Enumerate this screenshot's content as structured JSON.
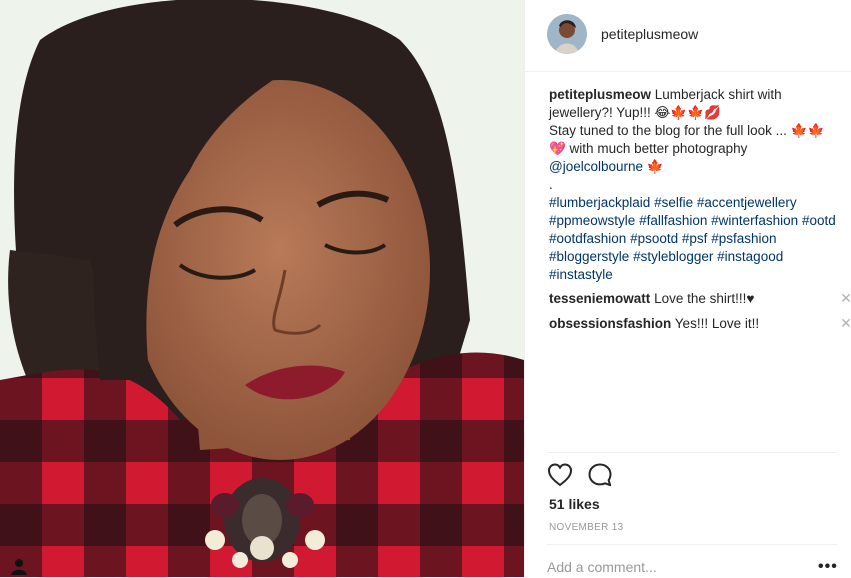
{
  "header": {
    "username": "petiteplusmeow"
  },
  "caption": {
    "username": "petiteplusmeow",
    "line1": "Lumberjack shirt with jewellery?! Yup!!! 😂🍁🍁💋",
    "line2": "Stay tuned to the blog for the full look ... 🍁🍁",
    "line3": "💖 with much better photography",
    "mention": "@joelcolbourne",
    "mention_suffix": " 🍁",
    "dot": ".",
    "hashtags": [
      "#lumberjackplaid",
      "#selfie",
      "#accentjewellery",
      "#ppmeowstyle",
      "#fallfashion",
      "#winterfashion",
      "#ootd",
      "#ootdfashion",
      "#psootd",
      "#psf",
      "#psfashion",
      "#bloggerstyle",
      "#styleblogger",
      "#instagood",
      "#instastyle"
    ]
  },
  "comments": [
    {
      "username": "tesseniemowatt",
      "text": "Love the shirt!!!♥",
      "delete_icon": "close-icon"
    },
    {
      "username": "obsessionsfashion",
      "text": "Yes!!! Love it!!",
      "delete_icon": "close-icon"
    }
  ],
  "actions": {
    "like_icon": "heart-icon",
    "comment_icon": "comment-bubble-icon"
  },
  "likes": "51 likes",
  "date": "NOVEMBER 13",
  "add_comment": {
    "placeholder": "Add a comment...",
    "more_label": "•••"
  },
  "colors": {
    "link": "#003569",
    "text": "#262626",
    "muted": "#999999",
    "plaid_red": "#c8102e",
    "plaid_dark": "#1a0d10"
  }
}
